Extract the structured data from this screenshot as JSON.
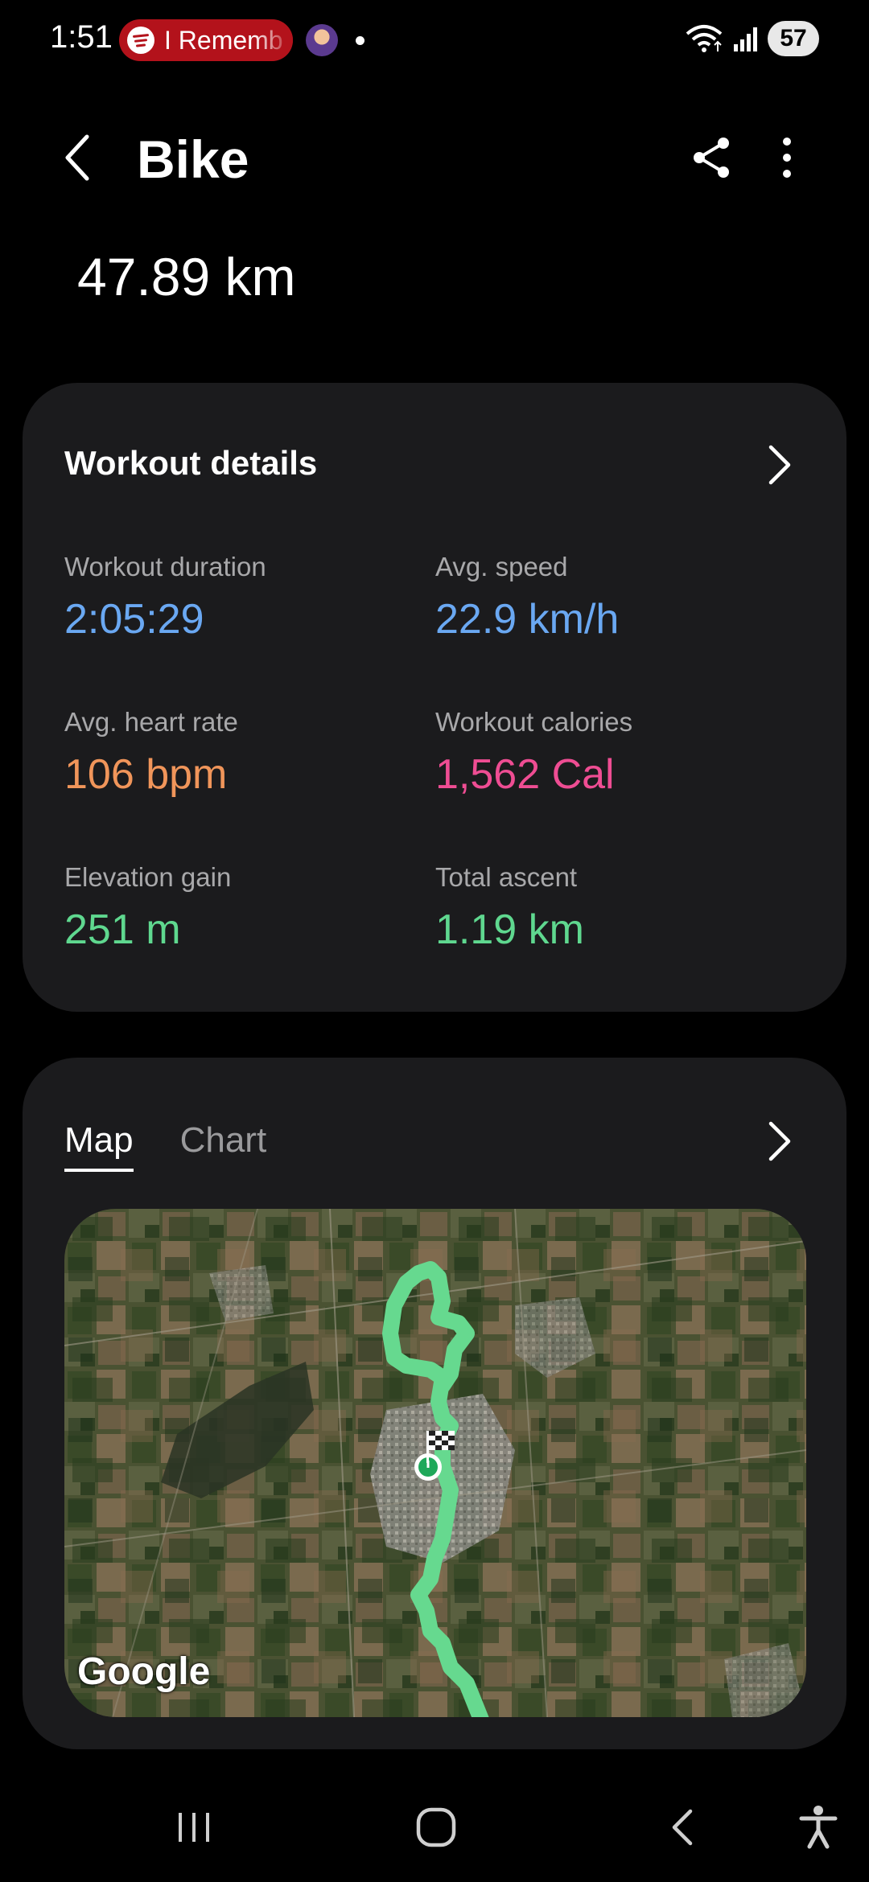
{
  "status_bar": {
    "time": "1:51",
    "media_text": "I Rememb",
    "battery": "57"
  },
  "header": {
    "title": "Bike",
    "distance": "47.89 km"
  },
  "workout_details": {
    "title": "Workout details",
    "stats": [
      {
        "label": "Workout duration",
        "value": "2:05:29",
        "color": "#6aa8f2"
      },
      {
        "label": "Avg. speed",
        "value": "22.9 km/h",
        "color": "#6aa8f2"
      },
      {
        "label": "Avg. heart rate",
        "value": "106 bpm",
        "color": "#f0955a"
      },
      {
        "label": "Workout calories",
        "value": "1,562 Cal",
        "color": "#ef4d93"
      },
      {
        "label": "Elevation gain",
        "value": "251 m",
        "color": "#5fd88f"
      },
      {
        "label": "Total ascent",
        "value": "1.19 km",
        "color": "#5fd88f"
      }
    ]
  },
  "map_card": {
    "tabs": [
      "Map",
      "Chart"
    ],
    "active_tab": "Map",
    "map_logo": "Google",
    "route_color": "#66d98f"
  },
  "colors": {
    "background": "#000000",
    "card": "#1b1b1d",
    "spotify_pill": "#b3121b"
  }
}
